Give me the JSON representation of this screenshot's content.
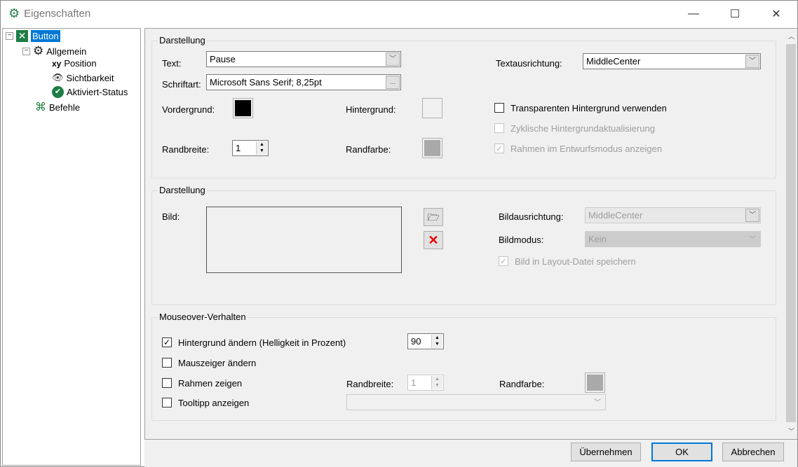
{
  "window": {
    "title": "Eigenschaften",
    "minimize": "—",
    "maximize": "☐",
    "close": "✕"
  },
  "tree": {
    "root": "Button",
    "allgemein": "Allgemein",
    "items": [
      "Position",
      "Sichtbarkeit",
      "Aktiviert-Status"
    ],
    "befehle": "Befehle"
  },
  "group1": {
    "legend": "Darstellung",
    "text_label": "Text:",
    "text_value": "Pause",
    "font_label": "Schriftart:",
    "font_value": "Microsoft Sans Serif; 8,25pt",
    "font_button": "...",
    "foreground_label": "Vordergrund:",
    "background_label": "Hintergrund:",
    "border_width_label": "Randbreite:",
    "border_width_value": "1",
    "border_color_label": "Randfarbe:",
    "align_label": "Textausrichtung:",
    "align_value": "MiddleCenter",
    "transparent_label": "Transparenten Hintergrund verwenden",
    "cyclic_label": "Zyklische Hintergrundaktualisierung",
    "frame_label": "Rahmen im Entwurfsmodus anzeigen",
    "colors": {
      "foreground": "#000000",
      "background": "#f0f0f0",
      "border": "#a9a9a9"
    }
  },
  "group2": {
    "legend": "Darstellung",
    "image_label": "Bild:",
    "image_align_label": "Bildausrichtung:",
    "image_align_value": "MiddleCenter",
    "image_mode_label": "Bildmodus:",
    "image_mode_value": "Kein",
    "save_label": "Bild in Layout-Datei speichern"
  },
  "group3": {
    "legend": "Mouseover-Verhalten",
    "bg_change_label": "Hintergrund ändern (Helligkeit in Prozent)",
    "bg_change_value": "90",
    "cursor_label": "Mauszeiger ändern",
    "frame_label": "Rahmen zeigen",
    "border_width_label": "Randbreite:",
    "border_width_value": "1",
    "border_color_label": "Randfarbe:",
    "tooltip_label": "Tooltipp anzeigen"
  },
  "buttons": {
    "apply": "Übernehmen",
    "ok": "OK",
    "cancel": "Abbrechen"
  }
}
